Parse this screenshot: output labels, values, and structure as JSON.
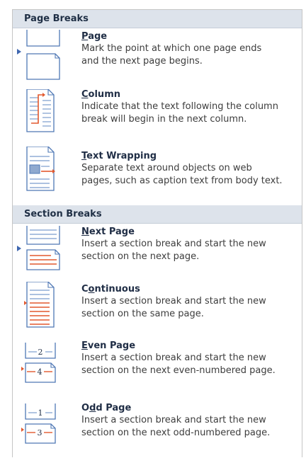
{
  "sections": [
    {
      "header": "Page Breaks",
      "items": [
        {
          "title": "Page",
          "mnemonic": "P",
          "desc_lines": [
            "Mark the point at which one page ends",
            "and the next page begins."
          ],
          "icon": "page-break-icon"
        },
        {
          "title": "Column",
          "mnemonic": "C",
          "desc_lines": [
            "Indicate that the text following the column",
            "break will begin in the next column."
          ],
          "icon": "column-break-icon"
        },
        {
          "title": "Text Wrapping",
          "mnemonic": "T",
          "desc_lines": [
            "Separate text around objects on web",
            "pages, such as caption text from body text."
          ],
          "icon": "text-wrapping-break-icon"
        }
      ]
    },
    {
      "header": "Section Breaks",
      "items": [
        {
          "title": "Next Page",
          "mnemonic": "N",
          "desc_lines": [
            "Insert a section break and start the new",
            "section on the next page."
          ],
          "icon": "next-page-section-break-icon"
        },
        {
          "title": "Continuous",
          "mnemonic": "o",
          "desc_lines": [
            "Insert a section break and start the new",
            "section on the same page."
          ],
          "icon": "continuous-section-break-icon"
        },
        {
          "title": "Even Page",
          "mnemonic": "E",
          "desc_lines": [
            "Insert a section break and start the new",
            "section on the next even-numbered page."
          ],
          "icon": "even-page-section-break-icon",
          "icon_numbers": [
            "2",
            "4"
          ]
        },
        {
          "title": "Odd Page",
          "mnemonic": "d",
          "desc_lines": [
            "Insert a section break and start the new",
            "section on the next odd-numbered page."
          ],
          "icon": "odd-page-section-break-icon",
          "icon_numbers": [
            "1",
            "3"
          ]
        }
      ]
    }
  ],
  "colors": {
    "header_bg": "#dde3eb",
    "accent_line": "#e2592e",
    "icon_blue": "#4f78b5",
    "title": "#1f2d45"
  }
}
